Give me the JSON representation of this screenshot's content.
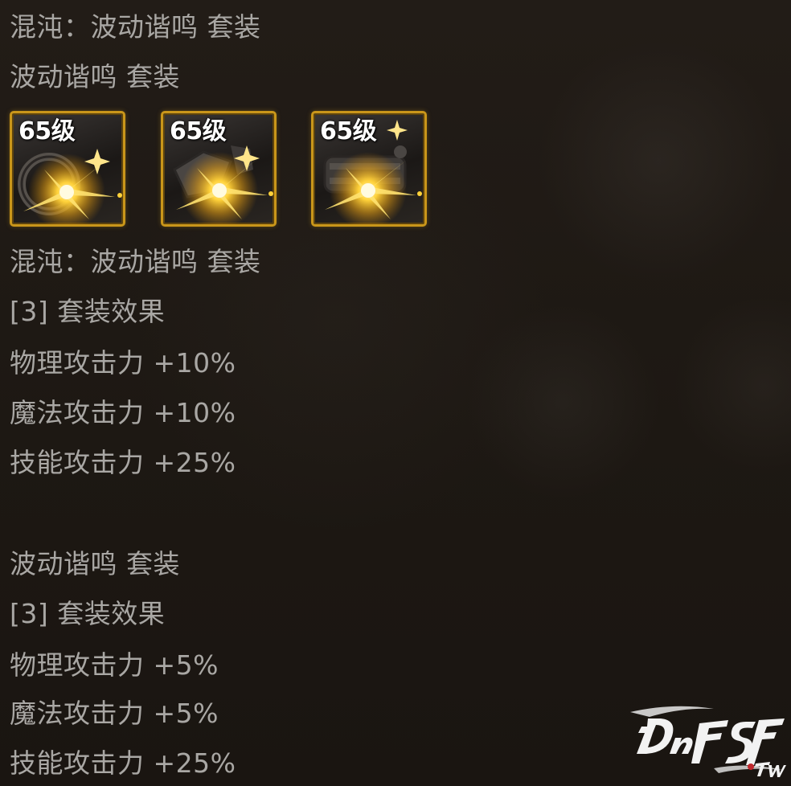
{
  "lines": {
    "header1": "混沌：波动谐鸣 套装",
    "header2": "波动谐鸣 套装",
    "chaos_title": "混沌：波动谐鸣 套装",
    "chaos_effect_title": "[3] 套装效果",
    "chaos_physical": "物理攻击力 +10%",
    "chaos_magic": "魔法攻击力 +10%",
    "chaos_skill": "技能攻击力 +25%",
    "normal_title": "波动谐鸣 套装",
    "normal_effect_title": "[3] 套装效果",
    "normal_physical": "物理攻击力 +5%",
    "normal_magic": "魔法攻击力 +5%",
    "normal_skill": "技能攻击力 +25%"
  },
  "items": [
    {
      "level_label": "65级",
      "icon": "ring-icon"
    },
    {
      "level_label": "65级",
      "icon": "necklace-icon"
    },
    {
      "level_label": "65级",
      "icon": "bracelet-icon"
    }
  ],
  "watermark": {
    "text": "DNFSF.TW",
    "icon": "dnfsf-logo-icon"
  },
  "colors": {
    "text": "#a9a7a4",
    "slot_border": "#c9961a",
    "sparkle": "#ffd23a",
    "background": "#1e1914"
  }
}
